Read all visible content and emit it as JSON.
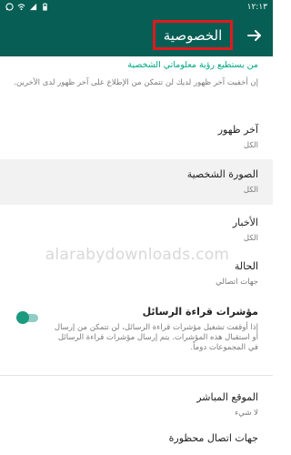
{
  "status_bar": {
    "time": "١٢:١٣",
    "icons": [
      "battery-icon",
      "signal-icon",
      "wifi-icon",
      "whatsapp-icon"
    ]
  },
  "app_bar": {
    "title": "الخصوصية",
    "back_icon": "arrow-icon",
    "background_color": "#075e54",
    "highlight_color": "#e0191f"
  },
  "section": {
    "header": "من يستطيع رؤية معلوماتي الشخصية",
    "description": "إن أخفيت آخر ظهور لديك لن تتمكن من الإطلاع على آخر ظهور لدى الآخرين.",
    "accent_color": "#00a884"
  },
  "settings": {
    "last_seen": {
      "label": "آخر ظهور",
      "value": "الكل"
    },
    "profile_photo": {
      "label": "الصورة الشخصية",
      "value": "الكل"
    },
    "about": {
      "label": "الأخبار",
      "value": "الكل"
    },
    "status": {
      "label": "الحالة",
      "value": "جهات اتصالي"
    },
    "read_receipts": {
      "label": "مؤشرات قراءة الرسائل",
      "description": "إذا أوقفت تشغيل مؤشرات قراءة الرسائل، لن تتمكن من إرسال أو استقبال هذه المؤشرات. يتم إرسال مؤشرات قراءة الرسائل في المجموعات دوماً.",
      "enabled": true
    },
    "live_location": {
      "label": "الموقع المباشر",
      "value": "لا شيء"
    },
    "blocked": {
      "label": "جهات اتصال محظورة"
    }
  },
  "watermark": "alarabydownloads.com"
}
